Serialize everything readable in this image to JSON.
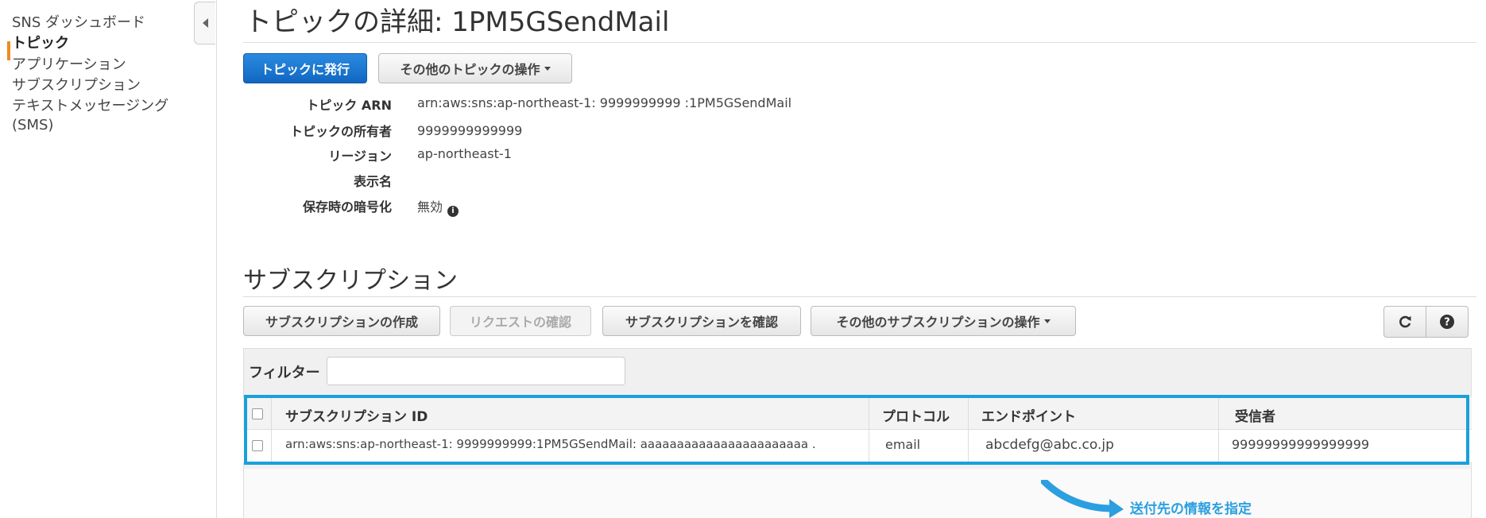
{
  "sidebar": {
    "items": [
      {
        "label": "SNS ダッシュボード"
      },
      {
        "label": "トピック"
      },
      {
        "label": "アプリケーション"
      },
      {
        "label": "サブスクリプション"
      },
      {
        "label": "テキストメッセージング"
      },
      {
        "label": "(SMS)"
      }
    ],
    "active_index": 1
  },
  "header": {
    "title": "トピックの詳細: 1PM5GSendMail"
  },
  "toolbar": {
    "publish_label": "トピックに発行",
    "other_actions_label": "その他のトピックの操作"
  },
  "details": [
    {
      "label": "トピック ARN",
      "value": "arn:aws:sns:ap-northeast-1: 9999999999 :1PM5GSendMail"
    },
    {
      "label": "トピックの所有者",
      "value": "9999999999999"
    },
    {
      "label": "リージョン",
      "value": "ap-northeast-1"
    },
    {
      "label": "表示名",
      "value": ""
    },
    {
      "label": "保存時の暗号化",
      "value": "無効"
    }
  ],
  "subscriptions": {
    "title": "サブスクリプション",
    "buttons": {
      "create": "サブスクリプションの作成",
      "request_confirm": "リクエストの確認",
      "confirm": "サブスクリプションを確認",
      "other_actions": "その他のサブスクリプションの操作"
    },
    "filter_label": "フィルター",
    "filter_value": "",
    "columns": [
      "サブスクリプション ID",
      "プロトコル",
      "エンドポイント",
      "受信者"
    ],
    "rows": [
      {
        "id": "arn:aws:sns:ap-northeast-1:  9999999999:1PM5GSendMail: aaaaaaaaaaaaaaaaaaaaaaa .",
        "protocol": "email",
        "endpoint": "abcdefg@abc.co.jp",
        "recipient": "99999999999999999"
      }
    ]
  },
  "annotation": {
    "text": "送付先の情報を指定"
  },
  "icons": {
    "collapse": "chevron-left-icon",
    "refresh": "refresh-icon",
    "help": "help-icon",
    "info": "info-icon",
    "caret": "caret-down-icon",
    "arrow": "arrow-icon"
  },
  "colors": {
    "primary_button": "#1166c1",
    "active_nav": "#f08a24",
    "highlight": "#1aa0dc",
    "annotation": "#2c9fe0"
  }
}
